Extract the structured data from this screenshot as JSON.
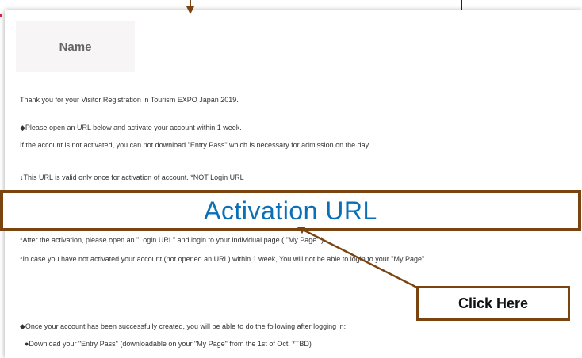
{
  "email": {
    "name_label": "Name",
    "greeting": "Thank you for your Visitor Registration in Tourism EXPO Japan 2019.",
    "instruction1": "◆Please open an URL below and activate your account within 1 week.",
    "instruction2": "If the account is not activated, you can not download \"Entry Pass\" which is necessary for admission on the day.",
    "url_note": "↓This URL is valid only once for activation of account.   *NOT Login URL",
    "activation_url_label": "Activation URL",
    "after1": "*After the activation, please open an \"Login URL\" and login to your individual page ( \"My Page\" ).",
    "after2": "*In case you have not activated your account (not opened an URL) within 1 week, You will not be able to login to your \"My Page\".",
    "once": "◆Once your account has been successfully created, you will be able to do the following after logging in:",
    "download": "●Download your \"Entry Pass\"     (downloadable on your \"My Page\" from the 1st of Oct. *TBD)"
  },
  "callout": {
    "label": "Click Here"
  },
  "colors": {
    "callout_border": "#7a4410",
    "link_text": "#0b6fb8"
  }
}
